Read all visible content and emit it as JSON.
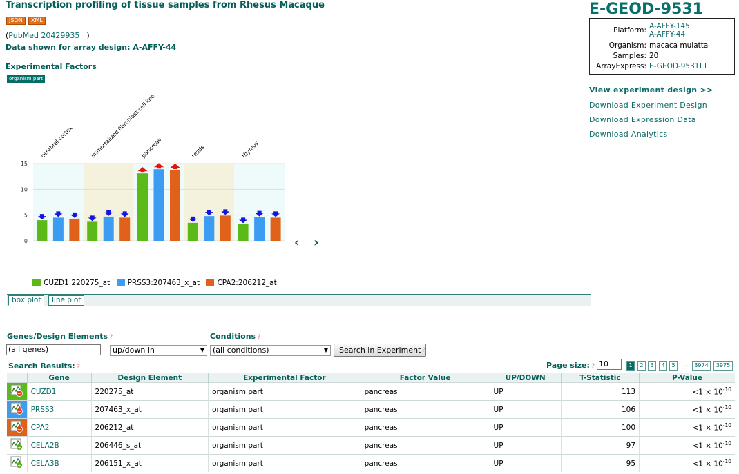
{
  "header": {
    "title": "Transcription profiling of tissue samples from Rhesus Macaque",
    "json_btn": "JSON",
    "xml_btn": "XML",
    "pubmed_prefix": "(",
    "pubmed_link": "PubMed 20429935",
    "pubmed_suffix": ")",
    "array_design": "Data shown for array design: A-AFFY-44",
    "exp_factors_label": "Experimental Factors",
    "factor_badge": "organism part"
  },
  "experiment": {
    "id": "E-GEOD-9531",
    "platform_label": "Platform:",
    "platforms": [
      "A-AFFY-145",
      "A-AFFY-44"
    ],
    "organism_label": "Organism:",
    "organism": "macaca mulatta",
    "samples_label": "Samples:",
    "samples": "20",
    "arrayexpress_label": "ArrayExpress:",
    "arrayexpress": "E-GEOD-9531"
  },
  "right_links": {
    "view_design": "View experiment design",
    "view_design_arrows": ">>",
    "download_design": "Download Experiment Design",
    "download_expression": "Download Expression Data",
    "download_analytics": "Download Analytics"
  },
  "chart_data": {
    "type": "bar",
    "categories": [
      "cerebral cortex",
      "immortalized fibroblast cell line",
      "pancreas",
      "testis",
      "thymus"
    ],
    "series": [
      {
        "name": "CUZD1:220275_at",
        "color": "#5cba18",
        "values": [
          4.0,
          3.7,
          13.1,
          3.5,
          3.3
        ],
        "direction": [
          "down",
          "down",
          "up",
          "down",
          "down"
        ]
      },
      {
        "name": "PRSS3:207463_x_at",
        "color": "#3b9cf2",
        "values": [
          4.5,
          4.7,
          13.9,
          4.8,
          4.6
        ],
        "direction": [
          "down",
          "down",
          "up",
          "down",
          "down"
        ]
      },
      {
        "name": "CPA2:206212_at",
        "color": "#e0621a",
        "values": [
          4.3,
          4.5,
          13.8,
          4.9,
          4.5
        ],
        "direction": [
          "down",
          "down",
          "up",
          "down",
          "down"
        ]
      }
    ],
    "yticks": [
      0,
      5,
      10,
      15
    ],
    "ylim": [
      0,
      15
    ],
    "grid": true,
    "legend_position": "bottom-left",
    "band_colors": [
      "#effbfb",
      "#f4f2dc"
    ],
    "up_color": "#e81010",
    "down_color": "#1414e0",
    "nav_prev": "‹",
    "nav_next": "›"
  },
  "plot_tabs": [
    "box plot",
    "line plot"
  ],
  "search": {
    "genes_label": "Genes/Design Elements",
    "genes_help": "?",
    "gene_input": "(all genes)",
    "updown_select": "up/down in",
    "conditions_label": "Conditions",
    "conditions_help": "?",
    "conditions_select": "(all conditions)",
    "search_button": "Search in Experiment",
    "search_help": "?",
    "results_label": "Search Results:",
    "results_help": "?",
    "page_size_label": "Page size:",
    "page_size_help": "?",
    "page_size": "10",
    "pages": [
      "1",
      "2",
      "3",
      "4",
      "5"
    ],
    "ellipsis": "...",
    "last_pages": [
      "3974",
      "3975"
    ]
  },
  "table": {
    "columns": [
      "Gene",
      "Design Element",
      "Experimental Factor",
      "Factor Value",
      "UP/DOWN",
      "T-Statistic",
      "P-Value"
    ],
    "rows": [
      {
        "gene": "CUZD1",
        "element": "220275_at",
        "factor": "organism part",
        "value": "pancreas",
        "updown": "UP",
        "t": "113",
        "p_base": "<1 × 10",
        "p_exp": "-10",
        "icon_color": "#5cba18",
        "icon_sign": "−"
      },
      {
        "gene": "PRSS3",
        "element": "207463_x_at",
        "factor": "organism part",
        "value": "pancreas",
        "updown": "UP",
        "t": "106",
        "p_base": "<1 × 10",
        "p_exp": "-10",
        "icon_color": "#3b9cf2",
        "icon_sign": "−"
      },
      {
        "gene": "CPA2",
        "element": "206212_at",
        "factor": "organism part",
        "value": "pancreas",
        "updown": "UP",
        "t": "100",
        "p_base": "<1 × 10",
        "p_exp": "-10",
        "icon_color": "#e0621a",
        "icon_sign": "−"
      },
      {
        "gene": "CELA2B",
        "element": "206446_s_at",
        "factor": "organism part",
        "value": "pancreas",
        "updown": "UP",
        "t": "97",
        "p_base": "<1 × 10",
        "p_exp": "-10",
        "icon_color": "#ffffff",
        "icon_sign": "+"
      },
      {
        "gene": "CELA3B",
        "element": "206151_x_at",
        "factor": "organism part",
        "value": "pancreas",
        "updown": "UP",
        "t": "95",
        "p_base": "<1 × 10",
        "p_exp": "-10",
        "icon_color": "#ffffff",
        "icon_sign": "+"
      }
    ]
  }
}
